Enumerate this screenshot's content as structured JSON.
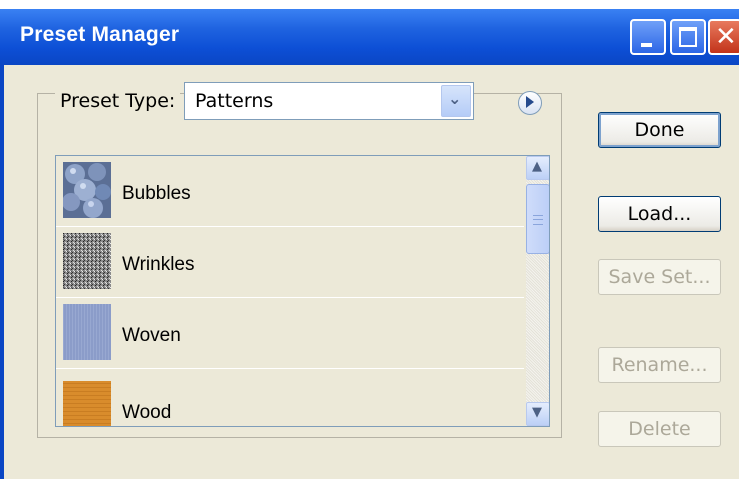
{
  "window": {
    "title": "Preset Manager"
  },
  "preset": {
    "label": "Preset Type:",
    "selected": "Patterns"
  },
  "list": {
    "items": [
      {
        "label": "Bubbles"
      },
      {
        "label": "Wrinkles"
      },
      {
        "label": "Woven"
      },
      {
        "label": "Wood"
      }
    ]
  },
  "buttons": {
    "done": "Done",
    "load": "Load...",
    "save_set": "Save Set...",
    "rename": "Rename...",
    "delete": "Delete"
  },
  "colors": {
    "titlebar": "#0a46c4",
    "dialog_bg": "#ece9d8",
    "wood_swatch": "#d98c2c",
    "woven_swatch": "#8b9cc9"
  }
}
